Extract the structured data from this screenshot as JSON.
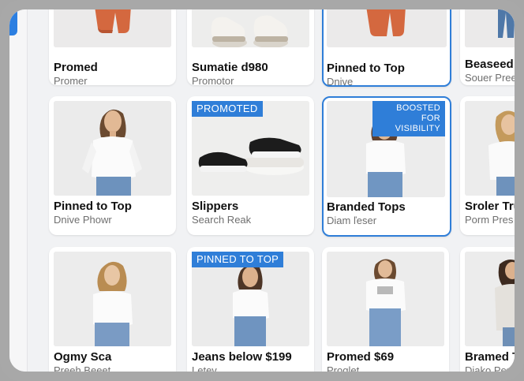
{
  "ui": {
    "accent_color": "#2f7ed8",
    "background_color": "#f1f2f4"
  },
  "products": {
    "row1": [
      {
        "title": "Promed",
        "subtitle": "Promer",
        "image": "orange-pants-photo"
      },
      {
        "title": "Sumatie d980",
        "subtitle": "Promotor",
        "image": "sneakers-photo"
      },
      {
        "title": "Pinned to Top",
        "subtitle": "Dnive",
        "image": "orange-pants-photo"
      },
      {
        "title": "Beaseed",
        "subtitle": "Souer Pree",
        "image": "jeans-photo"
      }
    ],
    "row2": [
      {
        "title": "Pinned to Top",
        "subtitle": "Dnive Phowr",
        "image": "woman-tee-jeans-photo"
      },
      {
        "title": "Slippers",
        "subtitle": "Search Reak",
        "badge": "PROMOTED",
        "image": "black-sandals-photo"
      },
      {
        "title": "Branded Tops",
        "subtitle": "Diam ľeser",
        "badge": "BOOSTED FOR VISIBILITY",
        "image": "woman-tee-jeans-photo"
      },
      {
        "title": "Sroler Tru",
        "subtitle": "Porm Pres",
        "image": "woman-white-top-photo"
      }
    ],
    "row3": [
      {
        "title": "Ogmy Sca",
        "subtitle": "Preeh Beeet",
        "image": "woman-tee-jeans-photo"
      },
      {
        "title": "Jeans below $199",
        "subtitle": "Letev",
        "badge": "PINNED TO TOP",
        "image": "woman-tee-jeans-photo"
      },
      {
        "title": "Promed $69",
        "subtitle": "Proglet",
        "image": "woman-graphic-tee-photo"
      },
      {
        "title": "Bramed Tu",
        "subtitle": "Diako Pere",
        "image": "woman-cardigan-photo"
      }
    ]
  }
}
